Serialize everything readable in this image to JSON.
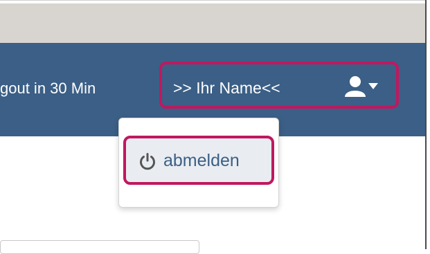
{
  "header": {
    "logout_timer": "gout in 30 Min",
    "user_name": ">> Ihr Name<<",
    "user_icon": "user-icon",
    "caret_icon": "caret-down-icon"
  },
  "user_dropdown": {
    "logout_label": "abmelden",
    "logout_icon": "power-icon"
  },
  "colors": {
    "navbar": "#3b5f86",
    "highlight": "#c0185f",
    "top_band": "#d8d4cf"
  }
}
